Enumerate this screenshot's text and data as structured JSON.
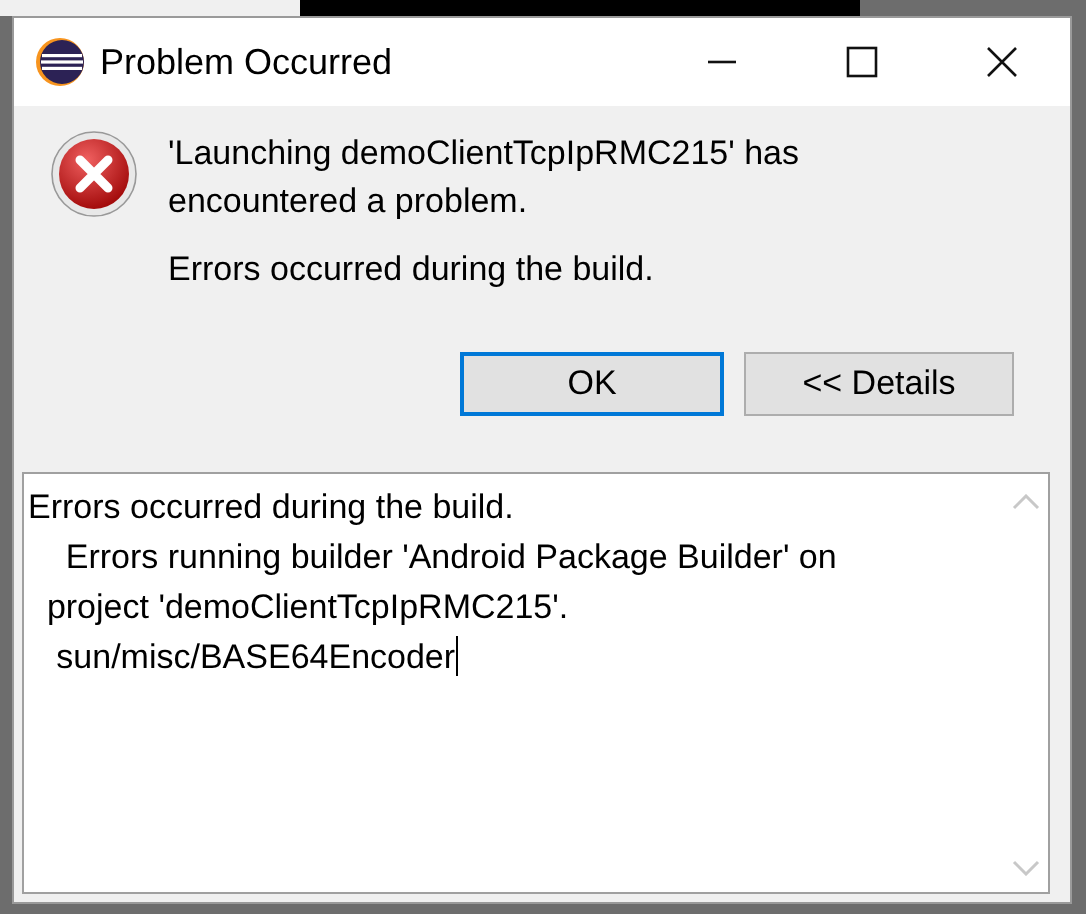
{
  "window": {
    "title": "Problem Occurred"
  },
  "message": {
    "kind": "error",
    "text": "'Launching demoClientTcpIpRMC215' has encountered a problem.",
    "detail": "Errors occurred during the build."
  },
  "buttons": [
    {
      "label": "OK",
      "default": true
    },
    {
      "label": "<< Details",
      "default": false
    }
  ],
  "details": {
    "lines": [
      "Errors occurred during the build.",
      "    Errors running builder 'Android Package Builder' on",
      "  project 'demoClientTcpIpRMC215'.",
      "   sun/misc/BASE64Encoder"
    ]
  }
}
